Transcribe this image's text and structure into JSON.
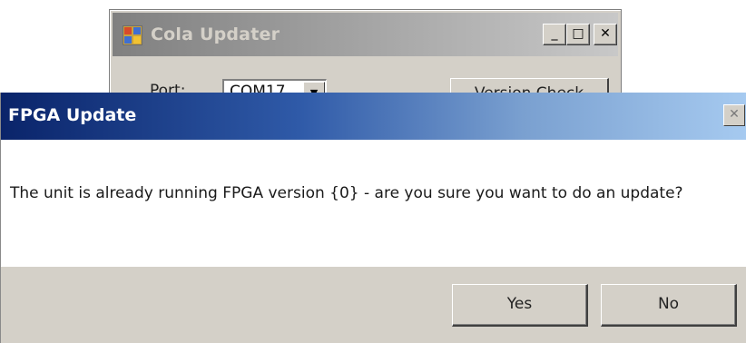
{
  "background_window": {
    "title": "Cola Updater",
    "caption_buttons": {
      "minimize": "_",
      "maximize": "□",
      "close": "✕"
    },
    "port_label": "Port:",
    "port_value": "COM17",
    "port_dropdown_arrow": "▼",
    "version_check_label": "Version Check"
  },
  "dialog": {
    "title": "FPGA Update",
    "close_glyph": "✕",
    "message": "The unit is already running FPGA version {0} - are you sure you want to do an update?",
    "yes_label": "Yes",
    "no_label": "No"
  },
  "icons": {
    "app_icon": "app-window-icon",
    "dropdown": "chevron-down-icon",
    "close": "close-icon",
    "minimize": "minimize-icon",
    "maximize": "maximize-icon"
  },
  "colors": {
    "dialog_titlebar_start": "#0a246a",
    "dialog_titlebar_end": "#a6caf0",
    "button_face": "#d4d0c8",
    "inactive_titlebar": "#808080"
  }
}
